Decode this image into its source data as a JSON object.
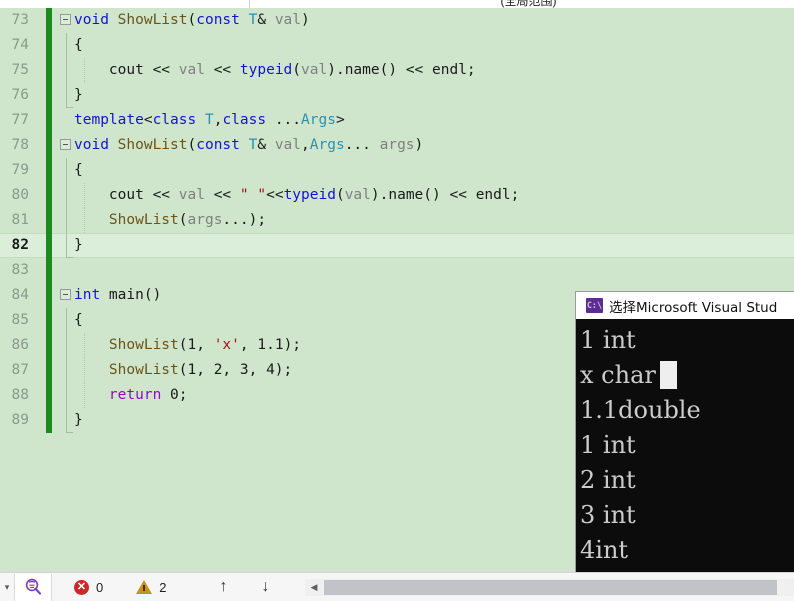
{
  "navbar": {
    "scope_left": "",
    "scope_right": "(全局范围)"
  },
  "editor": {
    "background_color": "#cfe6cd",
    "current_line": 82,
    "lines": [
      {
        "num": "73",
        "fold": true,
        "guide": "none",
        "indent": false,
        "changed": true,
        "tokens": [
          {
            "t": "void ",
            "c": "kw"
          },
          {
            "t": "ShowList",
            "c": "fn"
          },
          {
            "t": "(",
            "c": "pl"
          },
          {
            "t": "const ",
            "c": "kw"
          },
          {
            "t": "T",
            "c": "typ"
          },
          {
            "t": "& ",
            "c": "pl"
          },
          {
            "t": "val",
            "c": "var"
          },
          {
            "t": ")",
            "c": "pl"
          }
        ]
      },
      {
        "num": "74",
        "fold": false,
        "guide": "solid",
        "indent": false,
        "changed": true,
        "tokens": [
          {
            "t": "{",
            "c": "pl"
          }
        ]
      },
      {
        "num": "75",
        "fold": false,
        "guide": "solid",
        "indent": true,
        "changed": true,
        "tokens": [
          {
            "t": "    cout ",
            "c": "pl"
          },
          {
            "t": "<< ",
            "c": "pl"
          },
          {
            "t": "val ",
            "c": "var"
          },
          {
            "t": "<< ",
            "c": "pl"
          },
          {
            "t": "typeid",
            "c": "kw"
          },
          {
            "t": "(",
            "c": "pl"
          },
          {
            "t": "val",
            "c": "var"
          },
          {
            "t": ").name() ",
            "c": "pl"
          },
          {
            "t": "<< ",
            "c": "pl"
          },
          {
            "t": "endl;",
            "c": "pl"
          }
        ]
      },
      {
        "num": "76",
        "fold": false,
        "guide": "endcap",
        "indent": false,
        "changed": true,
        "tokens": [
          {
            "t": "}",
            "c": "pl"
          }
        ]
      },
      {
        "num": "77",
        "fold": false,
        "guide": "none",
        "indent": false,
        "changed": true,
        "tokens": [
          {
            "t": "template",
            "c": "kw"
          },
          {
            "t": "<",
            "c": "pl"
          },
          {
            "t": "class ",
            "c": "kw"
          },
          {
            "t": "T",
            "c": "typ"
          },
          {
            "t": ",",
            "c": "pl"
          },
          {
            "t": "class ",
            "c": "kw"
          },
          {
            "t": "...",
            "c": "pl"
          },
          {
            "t": "Args",
            "c": "typ"
          },
          {
            "t": ">",
            "c": "pl"
          }
        ]
      },
      {
        "num": "78",
        "fold": true,
        "guide": "none",
        "indent": false,
        "changed": true,
        "tokens": [
          {
            "t": "void ",
            "c": "kw"
          },
          {
            "t": "ShowList",
            "c": "fn"
          },
          {
            "t": "(",
            "c": "pl"
          },
          {
            "t": "const ",
            "c": "kw"
          },
          {
            "t": "T",
            "c": "typ"
          },
          {
            "t": "& ",
            "c": "pl"
          },
          {
            "t": "val",
            "c": "var"
          },
          {
            "t": ",",
            "c": "pl"
          },
          {
            "t": "Args",
            "c": "typ"
          },
          {
            "t": "... ",
            "c": "pl"
          },
          {
            "t": "args",
            "c": "var"
          },
          {
            "t": ")",
            "c": "pl"
          }
        ]
      },
      {
        "num": "79",
        "fold": false,
        "guide": "solid",
        "indent": false,
        "changed": true,
        "tokens": [
          {
            "t": "{",
            "c": "pl"
          }
        ]
      },
      {
        "num": "80",
        "fold": false,
        "guide": "solid",
        "indent": true,
        "changed": true,
        "tokens": [
          {
            "t": "    cout ",
            "c": "pl"
          },
          {
            "t": "<< ",
            "c": "pl"
          },
          {
            "t": "val ",
            "c": "var"
          },
          {
            "t": "<< ",
            "c": "pl"
          },
          {
            "t": "\" \"",
            "c": "str"
          },
          {
            "t": "<<",
            "c": "pl"
          },
          {
            "t": "typeid",
            "c": "kw"
          },
          {
            "t": "(",
            "c": "pl"
          },
          {
            "t": "val",
            "c": "var"
          },
          {
            "t": ").name() ",
            "c": "pl"
          },
          {
            "t": "<< ",
            "c": "pl"
          },
          {
            "t": "endl;",
            "c": "pl"
          }
        ]
      },
      {
        "num": "81",
        "fold": false,
        "guide": "solid",
        "indent": true,
        "changed": true,
        "tokens": [
          {
            "t": "    ShowList",
            "c": "fn"
          },
          {
            "t": "(",
            "c": "pl"
          },
          {
            "t": "args",
            "c": "var"
          },
          {
            "t": "...);",
            "c": "pl"
          }
        ]
      },
      {
        "num": "82",
        "fold": false,
        "guide": "endcap",
        "indent": false,
        "changed": true,
        "tokens": [
          {
            "t": "}",
            "c": "pl"
          }
        ]
      },
      {
        "num": "83",
        "fold": false,
        "guide": "none",
        "indent": false,
        "changed": true,
        "tokens": []
      },
      {
        "num": "84",
        "fold": true,
        "guide": "none",
        "indent": false,
        "changed": true,
        "tokens": [
          {
            "t": "int ",
            "c": "kw"
          },
          {
            "t": "main",
            "c": "pl"
          },
          {
            "t": "()",
            "c": "pl"
          }
        ]
      },
      {
        "num": "85",
        "fold": false,
        "guide": "solid",
        "indent": false,
        "changed": true,
        "tokens": [
          {
            "t": "{",
            "c": "pl"
          }
        ]
      },
      {
        "num": "86",
        "fold": false,
        "guide": "solid",
        "indent": true,
        "changed": true,
        "tokens": [
          {
            "t": "    ShowList",
            "c": "fn"
          },
          {
            "t": "(",
            "c": "pl"
          },
          {
            "t": "1, ",
            "c": "pl"
          },
          {
            "t": "'x'",
            "c": "str"
          },
          {
            "t": ", ",
            "c": "pl"
          },
          {
            "t": "1.1);",
            "c": "pl"
          }
        ]
      },
      {
        "num": "87",
        "fold": false,
        "guide": "solid",
        "indent": true,
        "changed": true,
        "tokens": [
          {
            "t": "    ShowList",
            "c": "fn"
          },
          {
            "t": "(",
            "c": "pl"
          },
          {
            "t": "1, 2, 3, 4);",
            "c": "pl"
          }
        ]
      },
      {
        "num": "88",
        "fold": false,
        "guide": "solid",
        "indent": true,
        "changed": true,
        "tokens": [
          {
            "t": "    return ",
            "c": "ctl"
          },
          {
            "t": "0;",
            "c": "pl"
          }
        ]
      },
      {
        "num": "89",
        "fold": false,
        "guide": "endcap",
        "indent": false,
        "changed": true,
        "tokens": [
          {
            "t": "}",
            "c": "pl"
          }
        ]
      }
    ]
  },
  "console": {
    "icon": "console-window-icon",
    "icon_glyph": "C:\\",
    "title": "选择Microsoft Visual Stud",
    "output_lines": [
      "1 int",
      "x char",
      "1.1double",
      "1 int",
      "2 int",
      "3 int",
      "4int"
    ],
    "cursor_line_index": 1,
    "background_color": "#0c0c0c",
    "text_color": "#cccccc"
  },
  "statusbar": {
    "dropdown_glyph": "▾",
    "tool_icon": "intellicode-icon",
    "error_icon": "error-circle-icon",
    "error_count": "0",
    "warning_icon": "warning-triangle-icon",
    "warning_count": "2",
    "up_arrow": "↑",
    "down_arrow": "↓",
    "scroll_left_glyph": "◀"
  }
}
